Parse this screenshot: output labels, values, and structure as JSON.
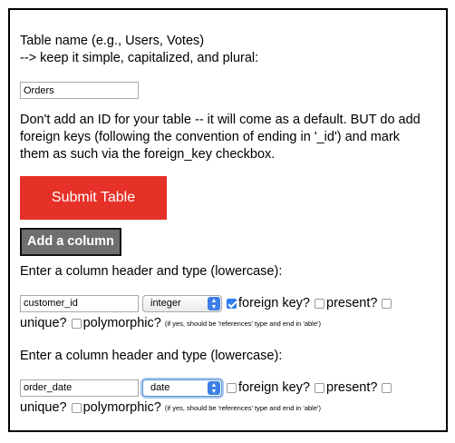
{
  "table_name": {
    "label_line1": "Table name (e.g., Users, Votes)",
    "label_line2": "--> keep it simple, capitalized, and plural:",
    "value": "Orders"
  },
  "instructions": {
    "line1": "Don't add an ID for your table -- it will come as a default. BUT do add",
    "line2": "foreign keys (following the convention of ending in '_id') and mark",
    "line3": "them as such via the foreign_key checkbox."
  },
  "buttons": {
    "submit_label": "Submit Table",
    "submit_color": "#e53128",
    "add_column_label": "Add a column"
  },
  "columns": [
    {
      "prompt": "Enter a column header and type (lowercase):",
      "header_value": "customer_id",
      "type_value": "integer",
      "foreign_key_label": "foreign key?",
      "foreign_key_checked": true,
      "present_label": "present?",
      "present_checked": false,
      "unique_label": "unique?",
      "unique_checked": false,
      "polymorphic_label": "polymorphic?",
      "polymorphic_checked": false,
      "polymorphic_note": "(if yes, should be 'references' type and end in 'able')"
    },
    {
      "prompt": "Enter a column header and type (lowercase):",
      "header_value": "order_date",
      "type_value": "date",
      "foreign_key_label": "foreign key?",
      "foreign_key_checked": false,
      "present_label": "present?",
      "present_checked": false,
      "unique_label": "unique?",
      "unique_checked": false,
      "polymorphic_label": "polymorphic?",
      "polymorphic_checked": false,
      "polymorphic_note": "(if yes, should be 'references' type and end in 'able')"
    }
  ]
}
